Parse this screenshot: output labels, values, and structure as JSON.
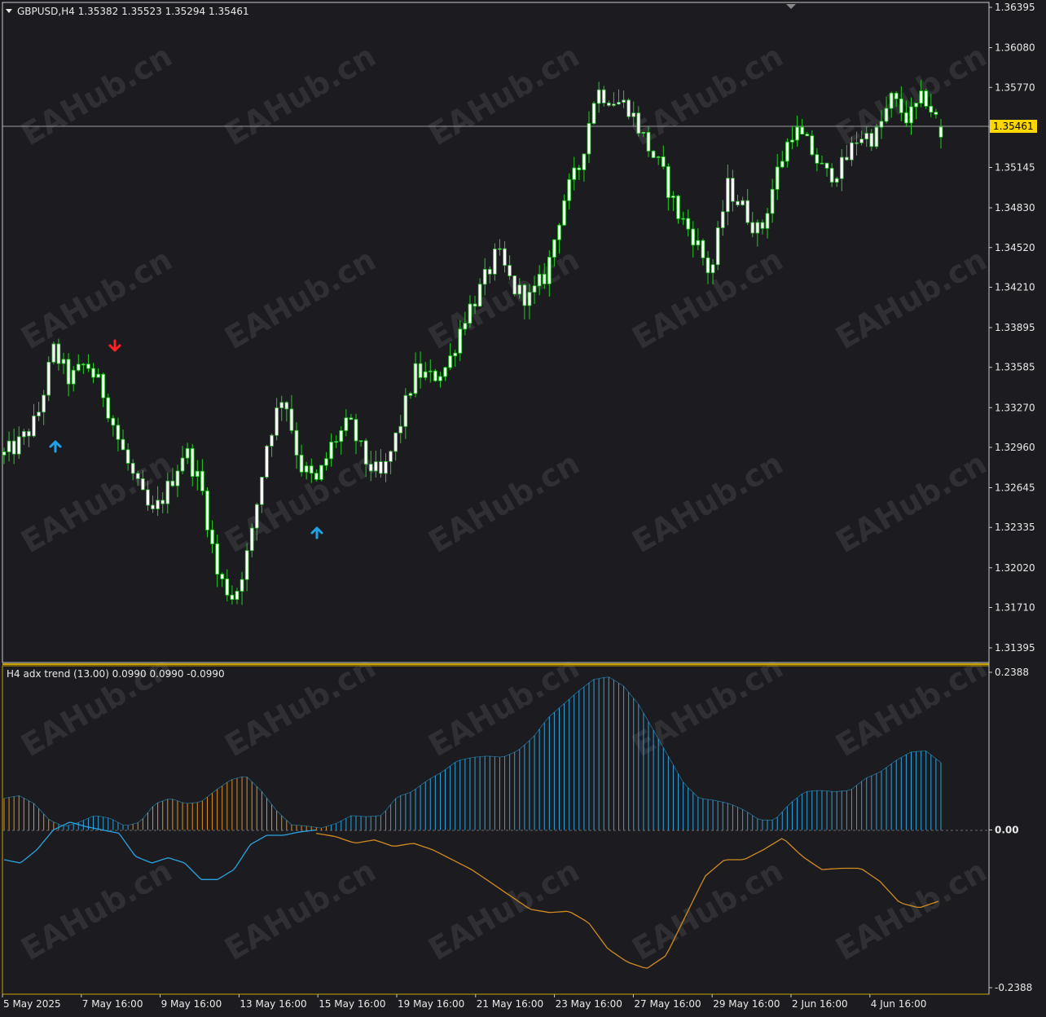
{
  "colors": {
    "background": "#1c1c20",
    "frame": "#c8c8c8",
    "separator": "#c8a000",
    "text": "#e8e8e8",
    "candle_bull": "#ffffff",
    "candle_bear": "#ffffff",
    "candle_wick": "#22cc22",
    "bid_line": "#9a9a9a",
    "price_tag_bg": "#ffd700",
    "price_tag_text": "#000000",
    "arrow_up": "#1fa3e8",
    "arrow_down": "#ff2222",
    "hist_blue": "#2aa3e0",
    "hist_orange": "#e0901a",
    "line_blue": "#2aa3e0",
    "line_orange": "#d08a20",
    "watermark": "rgba(255,255,255,0.09)"
  },
  "main": {
    "header": "GBPUSD,H4  1.35382 1.35523 1.35294 1.35461",
    "current_price": "1.35461",
    "price_ticks": [
      "1.36395",
      "1.36080",
      "1.35770",
      "1.35460",
      "1.35145",
      "1.34830",
      "1.34520",
      "1.34210",
      "1.33895",
      "1.33585",
      "1.33270",
      "1.32960",
      "1.32645",
      "1.32335",
      "1.32020",
      "1.31710",
      "1.31395"
    ]
  },
  "indicator": {
    "header": "H4 adx trend (13.00) 0.0990 0.0990 -0.0990",
    "ticks": [
      "0.2388",
      "0.00",
      "-0.2388"
    ]
  },
  "time_labels": [
    "5 May 2025",
    "7 May 16:00",
    "9 May 16:00",
    "13 May 16:00",
    "15 May 16:00",
    "19 May 16:00",
    "21 May 16:00",
    "23 May 16:00",
    "27 May 16:00",
    "29 May 16:00",
    "2 Jun 16:00",
    "4 Jun 16:00"
  ],
  "watermark_text": "EAHub.cn",
  "chart_data": [
    {
      "type": "candlestick",
      "symbol": "GBPUSD",
      "timeframe": "H4",
      "ylim": [
        1.31395,
        1.36395
      ],
      "x": [
        "5 May 2025",
        "7 May 16:00",
        "9 May 16:00",
        "13 May 16:00",
        "15 May 16:00",
        "19 May 16:00",
        "21 May 16:00",
        "23 May 16:00",
        "27 May 16:00",
        "29 May 16:00",
        "2 Jun 16:00",
        "4 Jun 16:00"
      ],
      "close_path": [
        1.329,
        1.33,
        1.3318,
        1.3372,
        1.3348,
        1.3362,
        1.334,
        1.33,
        1.3268,
        1.3242,
        1.3265,
        1.3295,
        1.3265,
        1.3195,
        1.3178,
        1.3222,
        1.33,
        1.334,
        1.3282,
        1.3268,
        1.33,
        1.3315,
        1.3285,
        1.3272,
        1.331,
        1.3355,
        1.335,
        1.336,
        1.3398,
        1.342,
        1.3448,
        1.342,
        1.3412,
        1.3432,
        1.3488,
        1.3515,
        1.3575,
        1.3568,
        1.3562,
        1.3535,
        1.3512,
        1.3478,
        1.346,
        1.343,
        1.35,
        1.3482,
        1.3462,
        1.351,
        1.3545,
        1.353,
        1.3508,
        1.3515,
        1.354,
        1.3538,
        1.3568,
        1.3552,
        1.357,
        1.3545
      ],
      "last": {
        "open": 1.35382,
        "high": 1.35523,
        "low": 1.35294,
        "close": 1.35461
      },
      "signals": [
        {
          "type": "sell_arrow",
          "at": "6 May"
        },
        {
          "type": "buy_arrow",
          "at": "6 May"
        },
        {
          "type": "buy_arrow",
          "at": "15 May"
        }
      ]
    },
    {
      "type": "histogram+line",
      "name": "adx trend",
      "period": 13.0,
      "values_shown": [
        0.099,
        0.099,
        -0.099
      ],
      "ylim": [
        -0.2388,
        0.2388
      ],
      "trend_histogram": [
        0.048,
        0.052,
        0.04,
        0.015,
        0.005,
        0.012,
        0.022,
        0.018,
        0.006,
        0.012,
        0.04,
        0.048,
        0.04,
        0.042,
        0.06,
        0.076,
        0.082,
        0.06,
        0.03,
        0.008,
        0.006,
        0.003,
        0.01,
        0.022,
        0.02,
        0.022,
        0.05,
        0.058,
        0.075,
        0.088,
        0.105,
        0.11,
        0.112,
        0.11,
        0.12,
        0.14,
        0.17,
        0.19,
        0.21,
        0.228,
        0.232,
        0.218,
        0.19,
        0.15,
        0.11,
        0.07,
        0.048,
        0.045,
        0.04,
        0.03,
        0.015,
        0.015,
        0.04,
        0.058,
        0.06,
        0.058,
        0.06,
        0.078,
        0.088,
        0.105,
        0.118,
        0.12,
        0.102
      ],
      "trend_color": [
        "o",
        "o",
        "o",
        "o",
        "b",
        "b",
        "b",
        "b",
        "b",
        "o",
        "o",
        "o",
        "o",
        "o",
        "o",
        "o",
        "o",
        "o",
        "o",
        "o",
        "o",
        "o",
        "b",
        "b",
        "b",
        "b",
        "b",
        "b",
        "b",
        "b",
        "b",
        "b",
        "b",
        "b",
        "b",
        "b",
        "b",
        "b",
        "b",
        "b",
        "b",
        "b",
        "b",
        "b",
        "b",
        "b",
        "b",
        "b",
        "b",
        "b",
        "b",
        "b",
        "b",
        "b",
        "b",
        "b",
        "b",
        "b",
        "b",
        "b",
        "b",
        "b",
        "b"
      ],
      "line_blue": [
        -0.045,
        -0.05,
        -0.03,
        0.0,
        0.012,
        0.005,
        0.0,
        -0.005,
        -0.04,
        -0.05,
        -0.042,
        -0.05,
        -0.075,
        -0.075,
        -0.06,
        -0.022,
        -0.008,
        -0.008,
        -0.003,
        0.0
      ],
      "line_orange": [
        -0.005,
        -0.01,
        -0.02,
        -0.015,
        -0.025,
        -0.02,
        -0.03,
        -0.045,
        -0.06,
        -0.08,
        -0.1,
        -0.12,
        -0.125,
        -0.123,
        -0.14,
        -0.18,
        -0.2,
        -0.21,
        -0.19,
        -0.13,
        -0.07,
        -0.045,
        -0.045,
        -0.03,
        -0.012,
        -0.04,
        -0.06,
        -0.058,
        -0.058,
        -0.078,
        -0.11,
        -0.118,
        -0.108
      ]
    }
  ]
}
